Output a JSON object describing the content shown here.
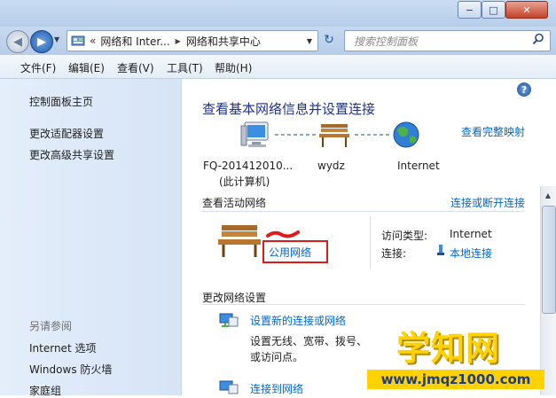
{
  "window": {
    "minimize_glyph": "−",
    "maximize_glyph": "□",
    "close_glyph": "✕"
  },
  "nav": {
    "back_glyph": "◀",
    "forward_glyph": "▶",
    "history_glyph": "▼",
    "refresh_glyph": "↻"
  },
  "address": {
    "prefix": "«",
    "segment1": "网络和 Inter...",
    "separator": "▶",
    "segment2": "网络和共享中心",
    "dropdown_glyph": "▼"
  },
  "search": {
    "placeholder": "搜索控制面板",
    "icon": "search-icon"
  },
  "menu": [
    "文件(F)",
    "编辑(E)",
    "查看(V)",
    "工具(T)",
    "帮助(H)"
  ],
  "sidebar": {
    "links": [
      "控制面板主页",
      "更改适配器设置",
      "更改高级共享设置"
    ],
    "see_also_title": "另请参阅",
    "see_also": [
      "Internet 选项",
      "Windows 防火墙",
      "家庭组"
    ]
  },
  "main": {
    "help": "?",
    "title": "查看基本网络信息并设置连接",
    "view_full_map": "查看完整映射",
    "map": {
      "computer_name": "FQ-201412010...",
      "computer_sub": "(此计算机)",
      "network_name": "wydz",
      "internet_label": "Internet"
    },
    "active": {
      "title": "查看活动网络",
      "connect_disconnect": "连接或断开连接",
      "network_type": "公用网络",
      "access_type_label": "访问类型:",
      "access_type_value": "Internet",
      "connection_label": "连接:",
      "connection_value": "本地连接"
    },
    "change": {
      "title": "更改网络设置",
      "task1_link": "设置新的连接或网络",
      "task1_desc_1": "设置无线、宽带、拨号、",
      "task1_desc_2": "或访问点。",
      "task2_link": "连接到网络"
    }
  },
  "watermark": {
    "main": "学知网",
    "url": "www.jmqz1000.com"
  },
  "colors": {
    "link": "#0066cc",
    "title": "#1e3287",
    "highlight": "#e01919",
    "watermark": "#ffd200"
  }
}
